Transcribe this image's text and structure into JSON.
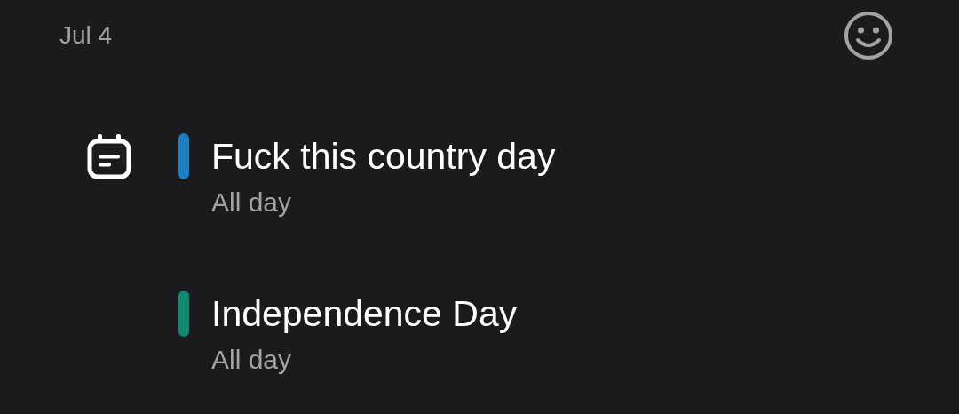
{
  "date": "Jul 4",
  "events": [
    {
      "kind": "note",
      "title": "Fuck this country day",
      "time": "All day",
      "color": "#1a7fc4"
    },
    {
      "kind": "holiday",
      "title": "Independence Day",
      "time": "All day",
      "color": "#0f8a72"
    }
  ]
}
